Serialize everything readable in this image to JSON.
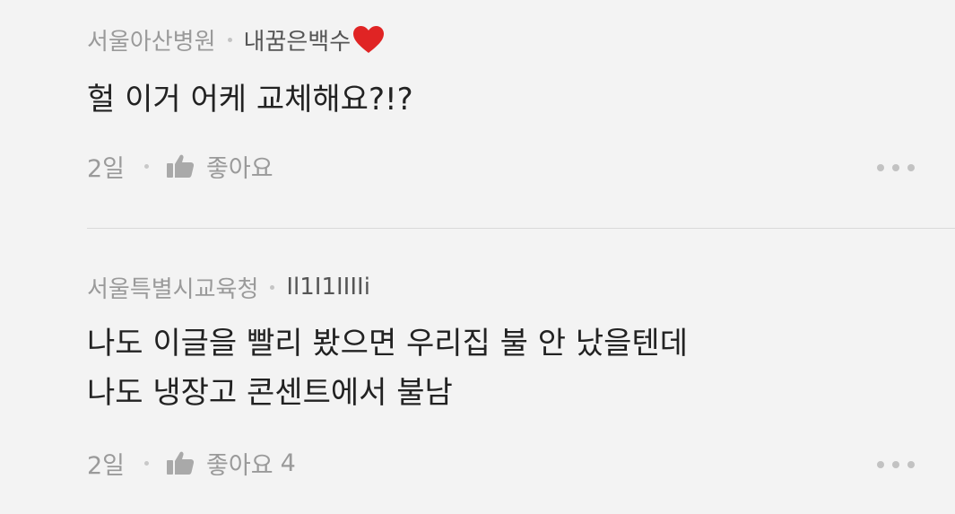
{
  "comments": [
    {
      "org": "서울아산병원",
      "nickname": "내꿈은백수",
      "nickname_icon": "heart-emoji",
      "lines": [
        "헐 이거 어케 교체해요?!?"
      ],
      "time": "2일",
      "like_label": "좋아요",
      "like_count": ""
    },
    {
      "org": "서울특별시교육청",
      "nickname": "Il1I1IIIIi",
      "lines": [
        "나도 이글을 빨리 봤으면 우리집 불 안 났을텐데",
        "나도 냉장고 콘센트에서 불남"
      ],
      "time": "2일",
      "like_label": "좋아요",
      "like_count": "4"
    }
  ],
  "icons": {
    "like": "thumbs-up-icon",
    "more": "more-dots-icon"
  },
  "colors": {
    "background": "#f3f3f3",
    "meta_text": "#9a9a9a",
    "body_text": "#222222",
    "heart": "#e02424"
  }
}
